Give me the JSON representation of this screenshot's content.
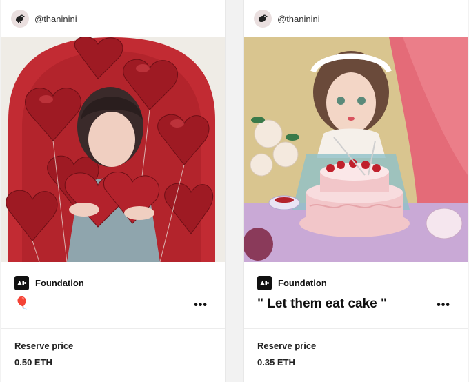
{
  "cards": [
    {
      "username": "@thaninini",
      "platform": "Foundation",
      "title": "🎈",
      "more_label": "•••",
      "reserve_label": "Reserve price",
      "reserve_value": "0.50 ETH"
    },
    {
      "username": "@thaninini",
      "platform": "Foundation",
      "title": "\" Let them eat cake \"",
      "more_label": "•••",
      "reserve_label": "Reserve price",
      "reserve_value": "0.35 ETH"
    }
  ],
  "icons": {
    "avatar": "bird-avatar-icon",
    "platform_logo": "foundation-logo-icon",
    "more": "more-options-icon"
  },
  "colors": {
    "balloon_red": "#b3222c",
    "cake_pink": "#f2c6c9"
  }
}
